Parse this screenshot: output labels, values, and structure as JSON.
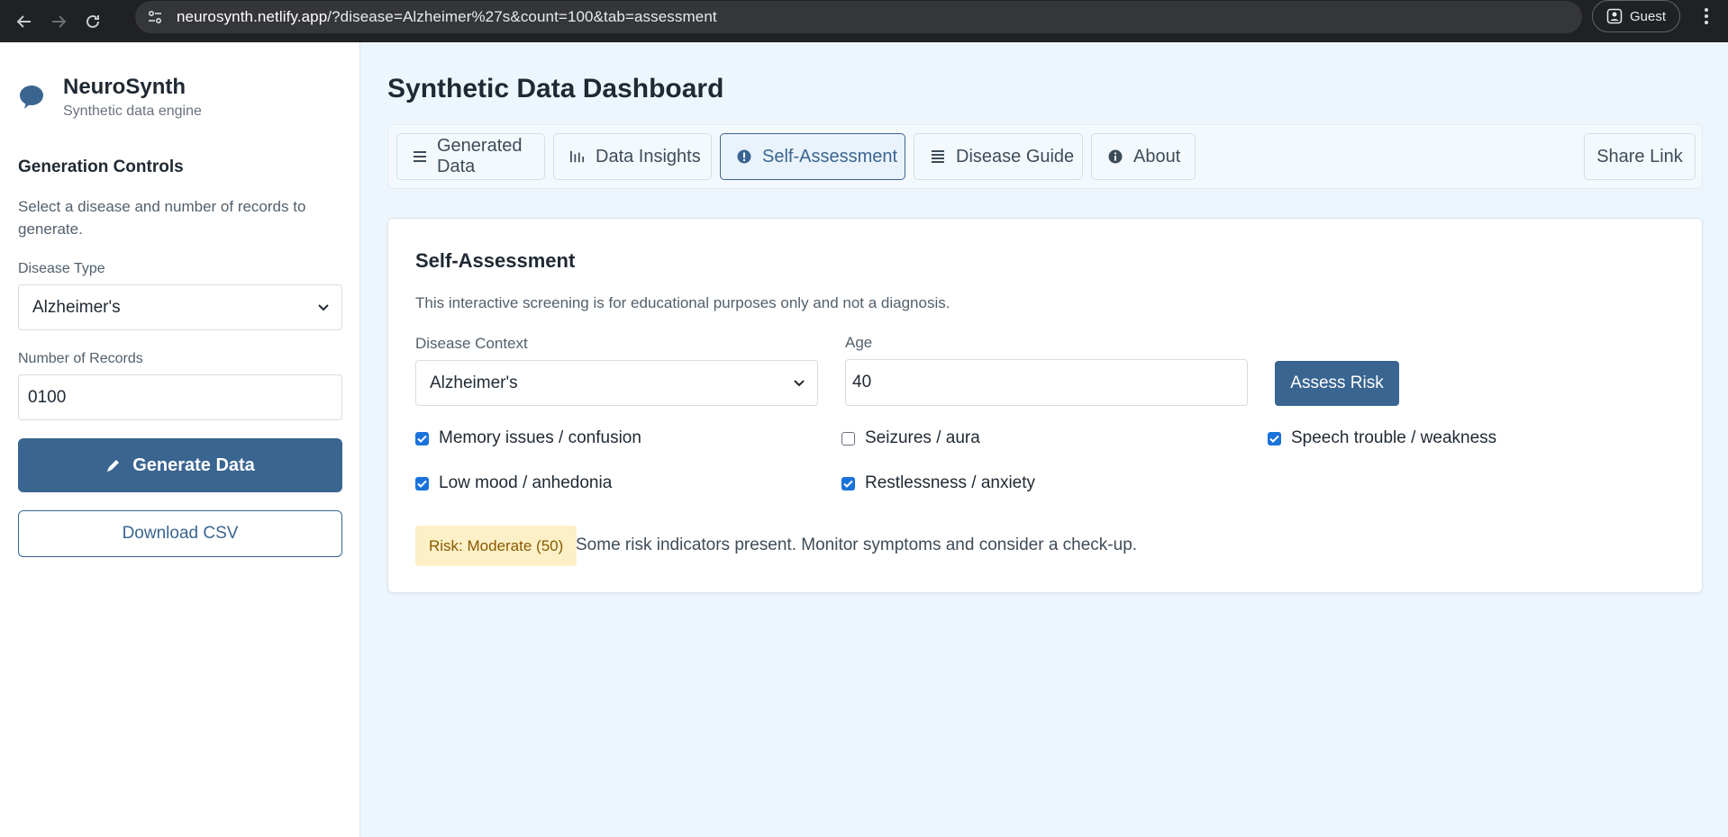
{
  "browser": {
    "url_host": "neurosynth.netlify.app",
    "url_path": "/?disease=Alzheimer%27s&count=100&tab=assessment",
    "profile_label": "Guest"
  },
  "sidebar": {
    "brand_title": "NeuroSynth",
    "brand_subtitle": "Synthetic data engine",
    "heading": "Generation Controls",
    "description": "Select a disease and number of records to generate.",
    "disease_label": "Disease Type",
    "disease_value": "Alzheimer's",
    "records_label": "Number of Records",
    "records_value": "0100",
    "generate_label": "Generate Data",
    "download_label": "Download CSV"
  },
  "main": {
    "title": "Synthetic Data Dashboard",
    "tabs": [
      {
        "label": "Generated Data",
        "icon": "list-icon"
      },
      {
        "label": "Data Insights",
        "icon": "bar-chart-icon"
      },
      {
        "label": "Self-Assessment",
        "icon": "alert-circle-icon",
        "active": true
      },
      {
        "label": "Disease Guide",
        "icon": "list-icon"
      },
      {
        "label": "About",
        "icon": "info-icon"
      }
    ],
    "share_label": "Share Link"
  },
  "assessment": {
    "title": "Self-Assessment",
    "description": "This interactive screening is for educational purposes only and not a diagnosis.",
    "context_label": "Disease Context",
    "context_value": "Alzheimer's",
    "age_label": "Age",
    "age_value": "40",
    "assess_label": "Assess Risk",
    "symptoms": [
      {
        "label": "Memory issues / confusion",
        "checked": true
      },
      {
        "label": "Seizures / aura",
        "checked": false
      },
      {
        "label": "Speech trouble / weakness",
        "checked": true
      },
      {
        "label": "Low mood / anhedonia",
        "checked": true
      },
      {
        "label": "Restlessness / anxiety",
        "checked": true
      }
    ],
    "risk_badge": "Risk: Moderate (50)",
    "risk_message": "Some risk indicators present. Monitor symptoms and consider a check-up."
  },
  "colors": {
    "primary": "#3a6591",
    "checkbox": "#1a73d9",
    "risk_bg": "#fdf0c7",
    "risk_fg": "#8a5a00"
  }
}
